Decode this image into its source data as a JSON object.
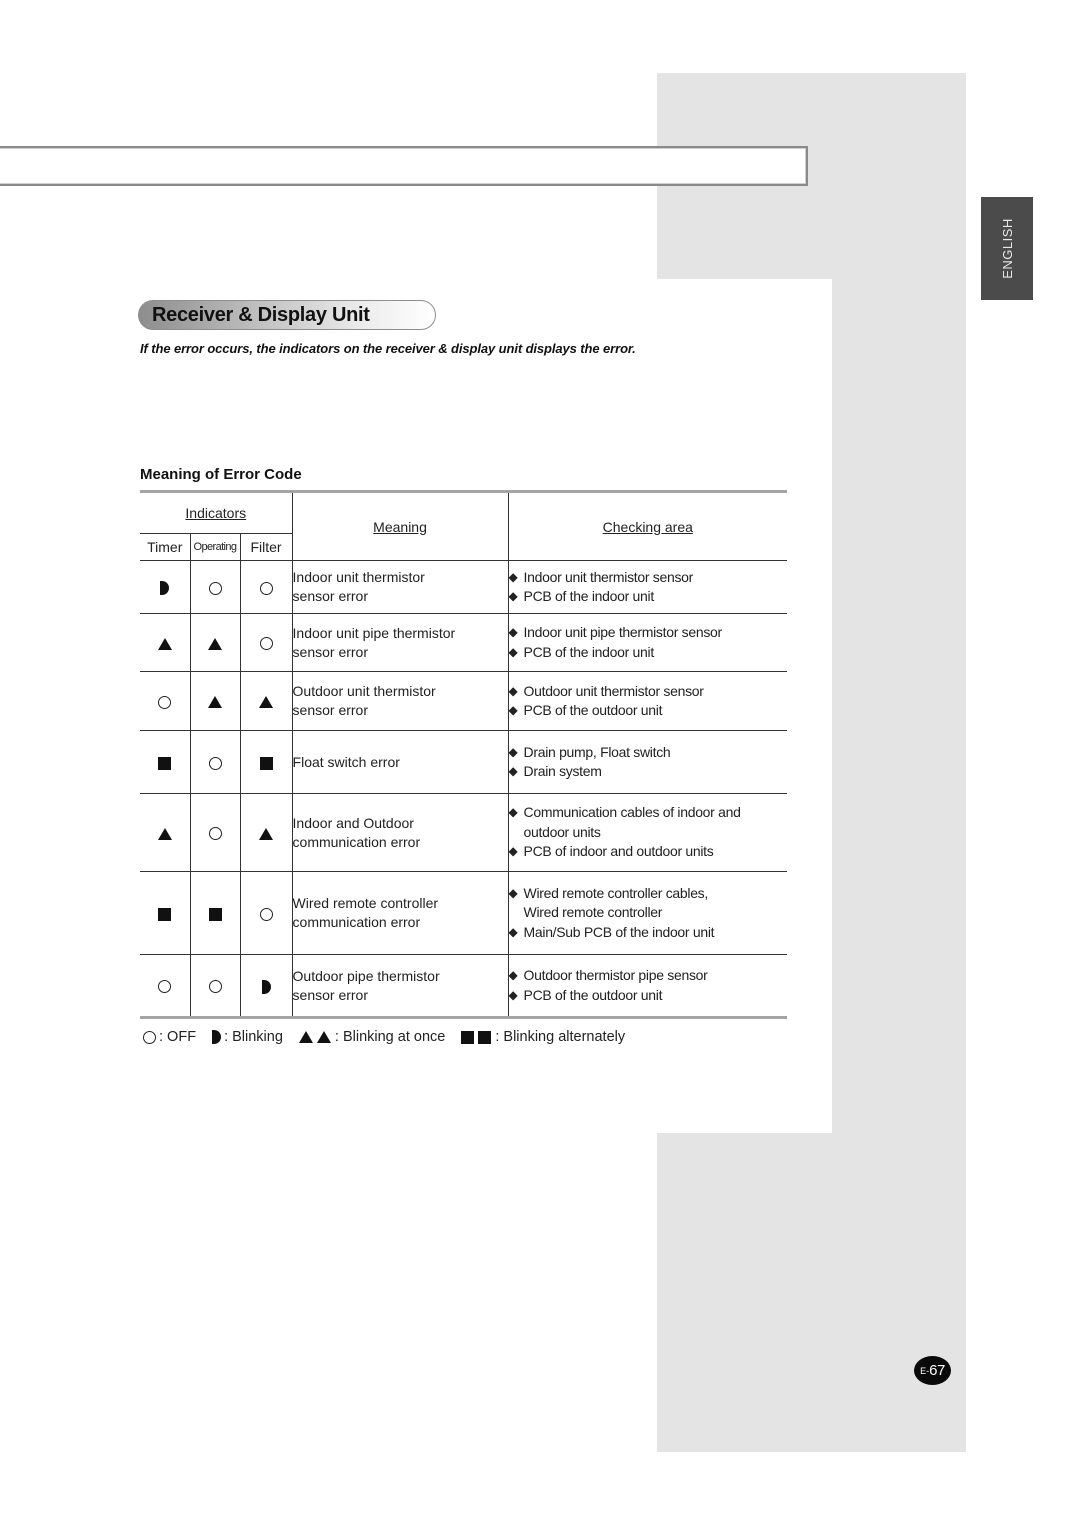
{
  "page": {
    "language_tab": "ENGLISH",
    "page_number_prefix": "E-",
    "page_number": "67"
  },
  "section": {
    "title": "Receiver & Display Unit",
    "intro": "If the error occurs, the indicators on the receiver & display unit displays the error.",
    "subheading": "Meaning of Error Code"
  },
  "table": {
    "headers": {
      "indicators": "Indicators",
      "timer": "Timer",
      "operating": "Operating",
      "filter": "Filter",
      "meaning": "Meaning",
      "checking_area": "Checking area"
    },
    "rows": [
      {
        "timer": "blinking",
        "operating": "off",
        "filter": "off",
        "meaning": [
          "Indoor unit thermistor",
          "sensor error"
        ],
        "checking": [
          {
            "text": "Indoor unit thermistor sensor",
            "bullet": true
          },
          {
            "text": "PCB of the indoor unit",
            "bullet": true
          }
        ]
      },
      {
        "timer": "blinking-at-once",
        "operating": "blinking-at-once",
        "filter": "off",
        "meaning": [
          "Indoor unit pipe thermistor",
          "sensor error"
        ],
        "checking": [
          {
            "text": "Indoor unit pipe thermistor sensor",
            "bullet": true
          },
          {
            "text": "PCB of the indoor unit",
            "bullet": true
          }
        ]
      },
      {
        "timer": "off",
        "operating": "blinking-at-once",
        "filter": "blinking-at-once",
        "meaning": [
          "Outdoor unit thermistor",
          "sensor error"
        ],
        "checking": [
          {
            "text": "Outdoor unit thermistor sensor",
            "bullet": true
          },
          {
            "text": "PCB of the outdoor unit",
            "bullet": true
          }
        ]
      },
      {
        "timer": "blinking-alternately",
        "operating": "off",
        "filter": "blinking-alternately",
        "meaning": [
          "Float switch error"
        ],
        "checking": [
          {
            "text": "Drain pump, Float switch",
            "bullet": true
          },
          {
            "text": "Drain system",
            "bullet": true
          }
        ]
      },
      {
        "timer": "blinking-at-once",
        "operating": "off",
        "filter": "blinking-at-once",
        "meaning": [
          "Indoor and Outdoor",
          "communication error"
        ],
        "checking": [
          {
            "text": "Communication cables of indoor and",
            "bullet": true
          },
          {
            "text": "outdoor units",
            "bullet": false
          },
          {
            "text": "PCB of indoor and outdoor units",
            "bullet": true
          }
        ]
      },
      {
        "timer": "blinking-alternately",
        "operating": "blinking-alternately",
        "filter": "off",
        "meaning": [
          "Wired remote controller",
          "communication error"
        ],
        "checking": [
          {
            "text": "Wired remote controller cables,",
            "bullet": true
          },
          {
            "text": "Wired remote controller",
            "bullet": false
          },
          {
            "text": "Main/Sub PCB of the indoor unit",
            "bullet": true
          }
        ]
      },
      {
        "timer": "off",
        "operating": "off",
        "filter": "blinking",
        "meaning": [
          "Outdoor pipe thermistor",
          "sensor error"
        ],
        "checking": [
          {
            "text": "Outdoor thermistor pipe sensor",
            "bullet": true
          },
          {
            "text": "PCB of the outdoor unit",
            "bullet": true
          }
        ]
      }
    ]
  },
  "legend": {
    "off": ": OFF",
    "blinking": ": Blinking",
    "blinking_at_once": ": Blinking at once",
    "blinking_alternately": ": Blinking alternately"
  },
  "symbols": {
    "off": "circle-outline-icon",
    "blinking": "half-circle-icon",
    "blinking-at-once": "triangle-icon",
    "blinking-alternately": "square-icon",
    "bullet": "◆"
  }
}
